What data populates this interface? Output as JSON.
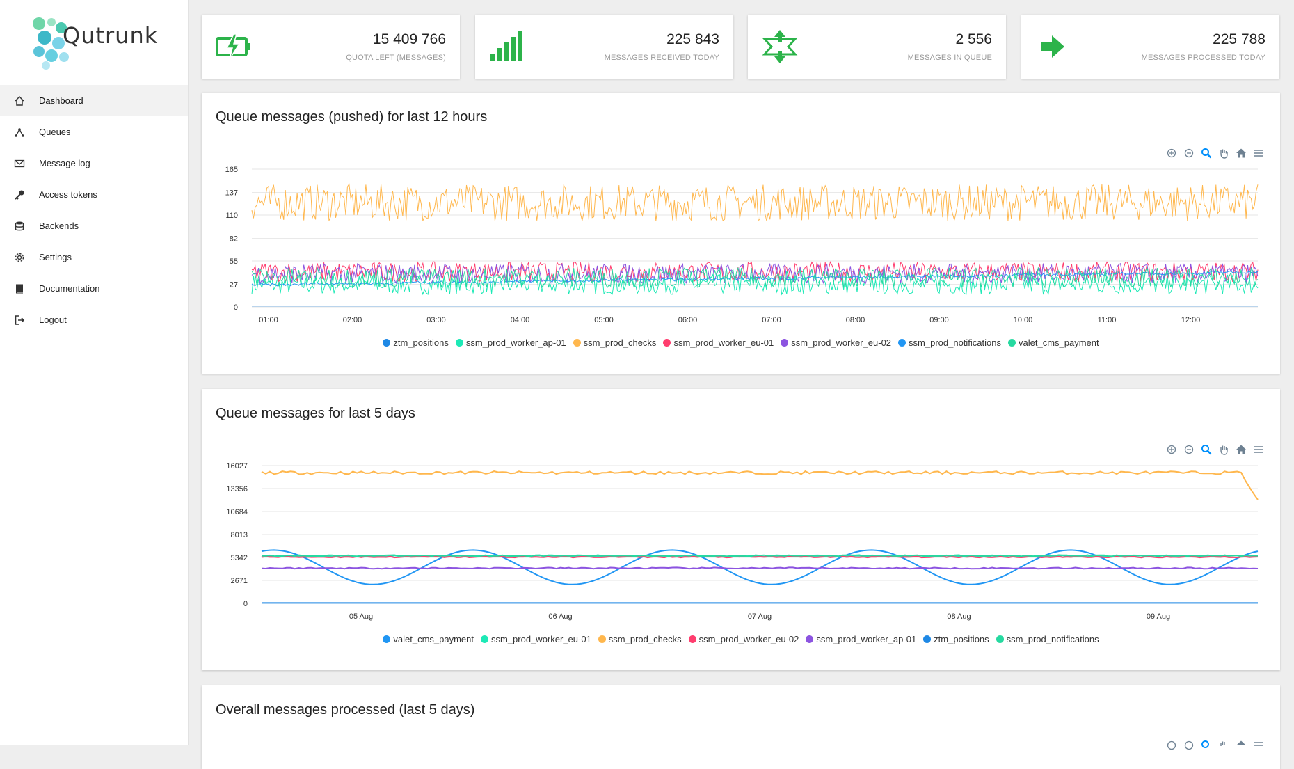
{
  "app": {
    "name": "Qutrunk"
  },
  "sidebar": {
    "items": [
      {
        "label": "Dashboard",
        "icon": "home-icon",
        "active": true
      },
      {
        "label": "Queues",
        "icon": "queues-icon"
      },
      {
        "label": "Message log",
        "icon": "envelope-icon"
      },
      {
        "label": "Access tokens",
        "icon": "key-icon"
      },
      {
        "label": "Backends",
        "icon": "database-icon"
      },
      {
        "label": "Settings",
        "icon": "gear-icon"
      },
      {
        "label": "Documentation",
        "icon": "book-icon"
      },
      {
        "label": "Logout",
        "icon": "logout-icon"
      }
    ]
  },
  "stats": [
    {
      "value": "15 409 766",
      "label": "QUOTA LEFT (MESSAGES)",
      "icon": "battery-charging-icon"
    },
    {
      "value": "225 843",
      "label": "MESSAGES RECEIVED TODAY",
      "icon": "signal-bars-icon"
    },
    {
      "value": "2 556",
      "label": "MESSAGES IN QUEUE",
      "icon": "compress-arrows-icon"
    },
    {
      "value": "225 788",
      "label": "MESSAGES PROCESSED TODAY",
      "icon": "arrow-right-icon"
    }
  ],
  "colors": {
    "accent_green": "#2cb34a",
    "blue": "#2196f3",
    "teal": "#1de9b6",
    "orange": "#ffb74d",
    "red": "#ff3d6e",
    "purple": "#8c54e0"
  },
  "charts": [
    {
      "title": "Queue messages (pushed) for last 12 hours"
    },
    {
      "title": "Queue messages for last 5 days"
    },
    {
      "title": "Overall messages processed (last 5 days)"
    }
  ],
  "chart_data": [
    {
      "type": "line",
      "title": "Queue messages (pushed) for last 12 hours",
      "x_ticks": [
        "01:00",
        "02:00",
        "03:00",
        "04:00",
        "05:00",
        "06:00",
        "07:00",
        "08:00",
        "09:00",
        "10:00",
        "11:00",
        "12:00"
      ],
      "y_ticks": [
        0,
        27,
        55,
        82,
        110,
        137,
        165
      ],
      "ylim": [
        0,
        165
      ],
      "grid": true,
      "legend_position": "bottom",
      "series": [
        {
          "name": "ztm_positions",
          "color": "#1e88e5",
          "approx_level": 1
        },
        {
          "name": "ssm_prod_worker_ap-01",
          "color": "#1de9b6",
          "approx_level": 27
        },
        {
          "name": "ssm_prod_checks",
          "color": "#ffb74d",
          "approx_level": 125
        },
        {
          "name": "ssm_prod_worker_eu-01",
          "color": "#ff3d6e",
          "approx_level": 42
        },
        {
          "name": "ssm_prod_worker_eu-02",
          "color": "#8c54e0",
          "approx_level": 40
        },
        {
          "name": "ssm_prod_notifications",
          "color": "#2196f3",
          "approx_level": 20
        },
        {
          "name": "valet_cms_payment",
          "color": "#26d9a0",
          "approx_level": 35
        }
      ]
    },
    {
      "type": "line",
      "title": "Queue messages for last 5 days",
      "x_ticks": [
        "05 Aug",
        "06 Aug",
        "07 Aug",
        "08 Aug",
        "09 Aug"
      ],
      "y_ticks": [
        0,
        2671,
        5342,
        8013,
        10684,
        13356,
        16027
      ],
      "ylim": [
        0,
        16027
      ],
      "grid": true,
      "legend_position": "bottom",
      "series": [
        {
          "name": "valet_cms_payment",
          "color": "#2196f3",
          "approx_level": 5600
        },
        {
          "name": "ssm_prod_worker_eu-01",
          "color": "#1de9b6",
          "approx_level": 5500
        },
        {
          "name": "ssm_prod_checks",
          "color": "#ffb74d",
          "approx_level": 15200
        },
        {
          "name": "ssm_prod_worker_eu-02",
          "color": "#ff3d6e",
          "approx_level": 5400
        },
        {
          "name": "ssm_prod_worker_ap-01",
          "color": "#8c54e0",
          "approx_level": 4100
        },
        {
          "name": "ztm_positions",
          "color": "#1e88e5",
          "approx_level": 50
        },
        {
          "name": "ssm_prod_notifications",
          "color": "#26d9a0",
          "approx_level": 5550
        }
      ]
    }
  ]
}
